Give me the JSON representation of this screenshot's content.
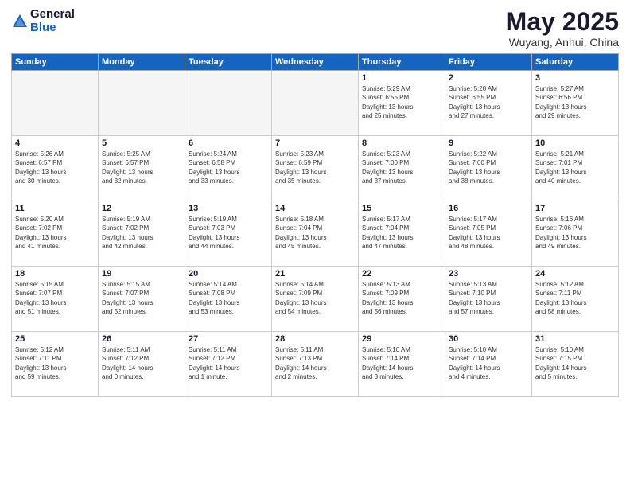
{
  "logo": {
    "general": "General",
    "blue": "Blue"
  },
  "header": {
    "title": "May 2025",
    "subtitle": "Wuyang, Anhui, China"
  },
  "weekdays": [
    "Sunday",
    "Monday",
    "Tuesday",
    "Wednesday",
    "Thursday",
    "Friday",
    "Saturday"
  ],
  "weeks": [
    [
      {
        "day": "",
        "info": ""
      },
      {
        "day": "",
        "info": ""
      },
      {
        "day": "",
        "info": ""
      },
      {
        "day": "",
        "info": ""
      },
      {
        "day": "1",
        "info": "Sunrise: 5:29 AM\nSunset: 6:55 PM\nDaylight: 13 hours\nand 25 minutes."
      },
      {
        "day": "2",
        "info": "Sunrise: 5:28 AM\nSunset: 6:55 PM\nDaylight: 13 hours\nand 27 minutes."
      },
      {
        "day": "3",
        "info": "Sunrise: 5:27 AM\nSunset: 6:56 PM\nDaylight: 13 hours\nand 29 minutes."
      }
    ],
    [
      {
        "day": "4",
        "info": "Sunrise: 5:26 AM\nSunset: 6:57 PM\nDaylight: 13 hours\nand 30 minutes."
      },
      {
        "day": "5",
        "info": "Sunrise: 5:25 AM\nSunset: 6:57 PM\nDaylight: 13 hours\nand 32 minutes."
      },
      {
        "day": "6",
        "info": "Sunrise: 5:24 AM\nSunset: 6:58 PM\nDaylight: 13 hours\nand 33 minutes."
      },
      {
        "day": "7",
        "info": "Sunrise: 5:23 AM\nSunset: 6:59 PM\nDaylight: 13 hours\nand 35 minutes."
      },
      {
        "day": "8",
        "info": "Sunrise: 5:23 AM\nSunset: 7:00 PM\nDaylight: 13 hours\nand 37 minutes."
      },
      {
        "day": "9",
        "info": "Sunrise: 5:22 AM\nSunset: 7:00 PM\nDaylight: 13 hours\nand 38 minutes."
      },
      {
        "day": "10",
        "info": "Sunrise: 5:21 AM\nSunset: 7:01 PM\nDaylight: 13 hours\nand 40 minutes."
      }
    ],
    [
      {
        "day": "11",
        "info": "Sunrise: 5:20 AM\nSunset: 7:02 PM\nDaylight: 13 hours\nand 41 minutes."
      },
      {
        "day": "12",
        "info": "Sunrise: 5:19 AM\nSunset: 7:02 PM\nDaylight: 13 hours\nand 42 minutes."
      },
      {
        "day": "13",
        "info": "Sunrise: 5:19 AM\nSunset: 7:03 PM\nDaylight: 13 hours\nand 44 minutes."
      },
      {
        "day": "14",
        "info": "Sunrise: 5:18 AM\nSunset: 7:04 PM\nDaylight: 13 hours\nand 45 minutes."
      },
      {
        "day": "15",
        "info": "Sunrise: 5:17 AM\nSunset: 7:04 PM\nDaylight: 13 hours\nand 47 minutes."
      },
      {
        "day": "16",
        "info": "Sunrise: 5:17 AM\nSunset: 7:05 PM\nDaylight: 13 hours\nand 48 minutes."
      },
      {
        "day": "17",
        "info": "Sunrise: 5:16 AM\nSunset: 7:06 PM\nDaylight: 13 hours\nand 49 minutes."
      }
    ],
    [
      {
        "day": "18",
        "info": "Sunrise: 5:15 AM\nSunset: 7:07 PM\nDaylight: 13 hours\nand 51 minutes."
      },
      {
        "day": "19",
        "info": "Sunrise: 5:15 AM\nSunset: 7:07 PM\nDaylight: 13 hours\nand 52 minutes."
      },
      {
        "day": "20",
        "info": "Sunrise: 5:14 AM\nSunset: 7:08 PM\nDaylight: 13 hours\nand 53 minutes."
      },
      {
        "day": "21",
        "info": "Sunrise: 5:14 AM\nSunset: 7:09 PM\nDaylight: 13 hours\nand 54 minutes."
      },
      {
        "day": "22",
        "info": "Sunrise: 5:13 AM\nSunset: 7:09 PM\nDaylight: 13 hours\nand 56 minutes."
      },
      {
        "day": "23",
        "info": "Sunrise: 5:13 AM\nSunset: 7:10 PM\nDaylight: 13 hours\nand 57 minutes."
      },
      {
        "day": "24",
        "info": "Sunrise: 5:12 AM\nSunset: 7:11 PM\nDaylight: 13 hours\nand 58 minutes."
      }
    ],
    [
      {
        "day": "25",
        "info": "Sunrise: 5:12 AM\nSunset: 7:11 PM\nDaylight: 13 hours\nand 59 minutes."
      },
      {
        "day": "26",
        "info": "Sunrise: 5:11 AM\nSunset: 7:12 PM\nDaylight: 14 hours\nand 0 minutes."
      },
      {
        "day": "27",
        "info": "Sunrise: 5:11 AM\nSunset: 7:12 PM\nDaylight: 14 hours\nand 1 minute."
      },
      {
        "day": "28",
        "info": "Sunrise: 5:11 AM\nSunset: 7:13 PM\nDaylight: 14 hours\nand 2 minutes."
      },
      {
        "day": "29",
        "info": "Sunrise: 5:10 AM\nSunset: 7:14 PM\nDaylight: 14 hours\nand 3 minutes."
      },
      {
        "day": "30",
        "info": "Sunrise: 5:10 AM\nSunset: 7:14 PM\nDaylight: 14 hours\nand 4 minutes."
      },
      {
        "day": "31",
        "info": "Sunrise: 5:10 AM\nSunset: 7:15 PM\nDaylight: 14 hours\nand 5 minutes."
      }
    ]
  ]
}
